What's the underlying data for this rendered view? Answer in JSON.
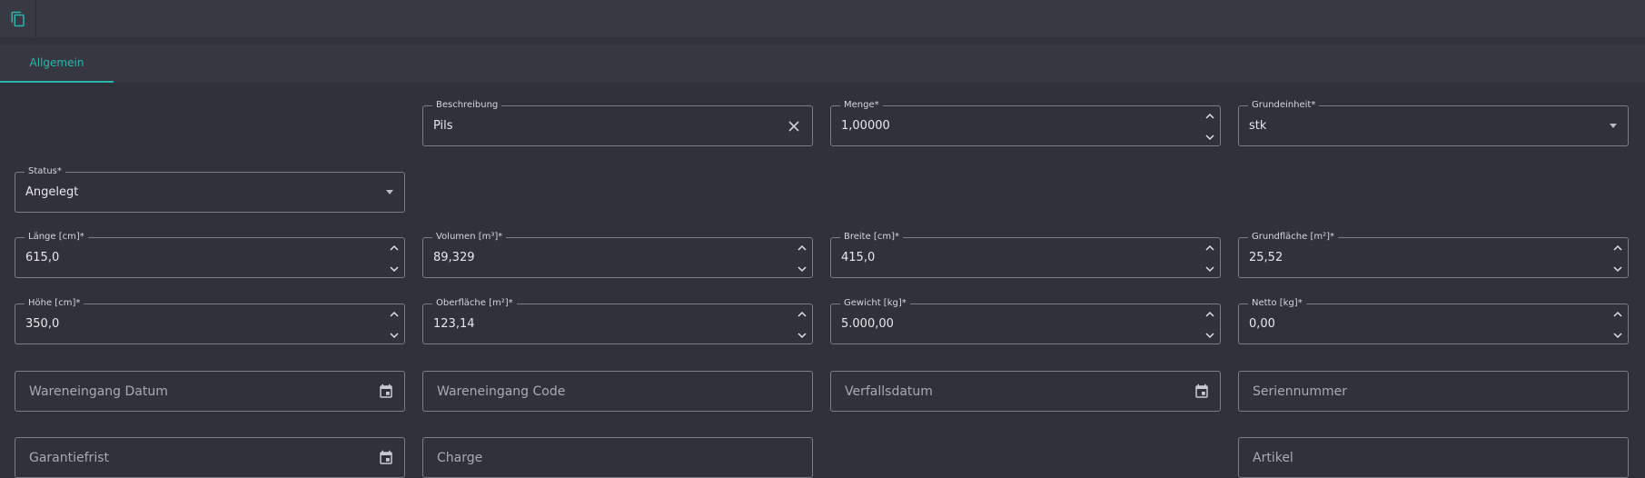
{
  "tabs": [
    {
      "label": "Allgemein"
    }
  ],
  "fields": {
    "beschreibung": {
      "label": "Beschreibung",
      "value": "Pils"
    },
    "menge": {
      "label": "Menge*",
      "value": "1,00000"
    },
    "grundeinheit": {
      "label": "Grundeinheit*",
      "value": "stk"
    },
    "status": {
      "label": "Status*",
      "value": "Angelegt"
    },
    "laenge": {
      "label": "Länge [cm]*",
      "value": "615,0"
    },
    "volumen": {
      "label": "Volumen [m³]*",
      "value": "89,329"
    },
    "breite": {
      "label": "Breite [cm]*",
      "value": "415,0"
    },
    "grundflaeche": {
      "label": "Grundfläche [m²]*",
      "value": "25,52"
    },
    "hoehe": {
      "label": "Höhe [cm]*",
      "value": "350,0"
    },
    "oberflaeche": {
      "label": "Oberfläche [m²]*",
      "value": "123,14"
    },
    "gewicht": {
      "label": "Gewicht [kg]*",
      "value": "5.000,00"
    },
    "netto": {
      "label": "Netto [kg]*",
      "value": "0,00"
    },
    "wareneingang_datum": {
      "placeholder": "Wareneingang Datum"
    },
    "wareneingang_code": {
      "placeholder": "Wareneingang Code"
    },
    "verfallsdatum": {
      "placeholder": "Verfallsdatum"
    },
    "seriennummer": {
      "placeholder": "Seriennummer"
    },
    "garantiefrist": {
      "placeholder": "Garantiefrist"
    },
    "charge": {
      "placeholder": "Charge"
    },
    "artikel": {
      "placeholder": "Artikel"
    }
  },
  "colors": {
    "accent": "#2bb6ad",
    "background": "#30313a",
    "toolbar": "#383943"
  },
  "icons": {
    "toolbar": "copy-icon",
    "clear": "close-icon",
    "date": "calendar-icon",
    "select": "caret-down-icon",
    "spin_up": "chevron-up-icon",
    "spin_down": "chevron-down-icon"
  }
}
